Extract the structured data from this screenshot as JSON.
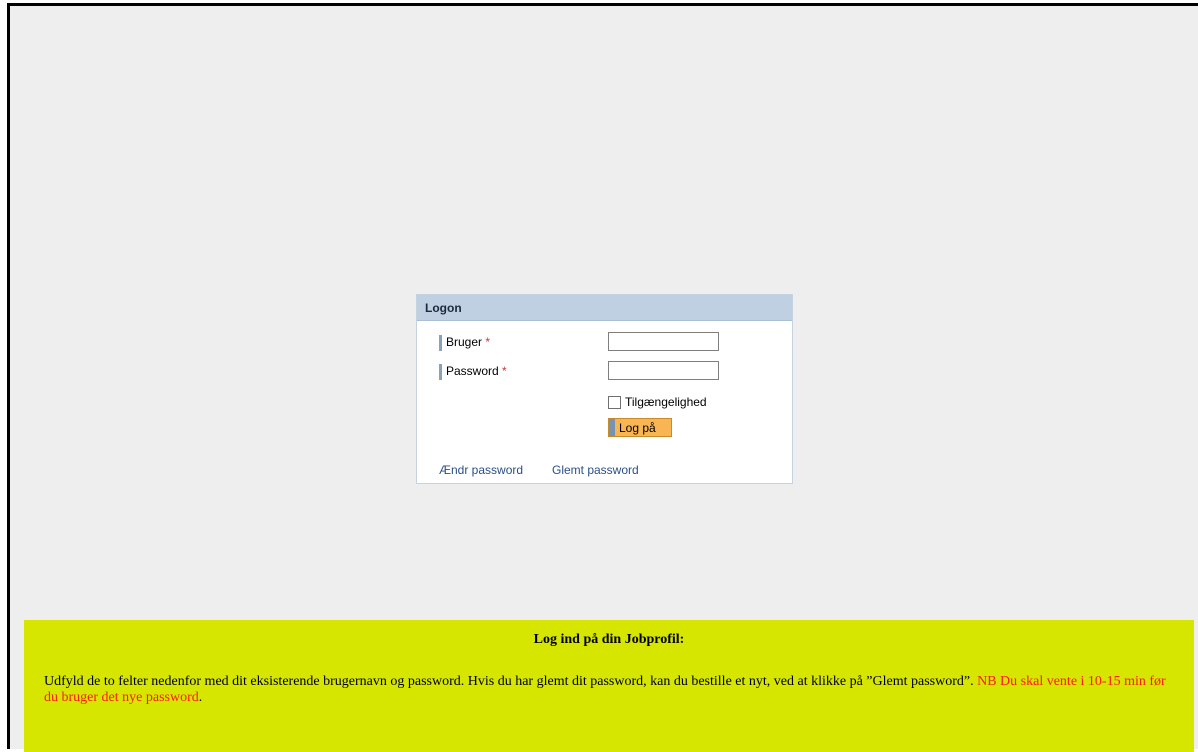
{
  "logon": {
    "title": "Logon",
    "user_label": "Bruger",
    "password_label": "Password",
    "required_marker": "*",
    "user_value": "",
    "password_value": "",
    "accessibility_label": "Tilgængelighed",
    "accessibility_checked": false,
    "login_button": "Log på",
    "change_password_link": "Ændr password",
    "forgot_password_link": "Glemt password"
  },
  "info": {
    "title": "Log ind på din Jobprofil:",
    "text": "Udfyld de to felter nedenfor med dit eksisterende brugernavn og password. Hvis du har glemt dit password, kan du bestille et nyt, ved at klikke på ”Glemt password”. ",
    "notice": "NB Du skal vente i 10-15 min før du bruger det nye password",
    "notice_tail": ".",
    "background_color": "#d6e600",
    "notice_color": "#ff1a1a"
  }
}
